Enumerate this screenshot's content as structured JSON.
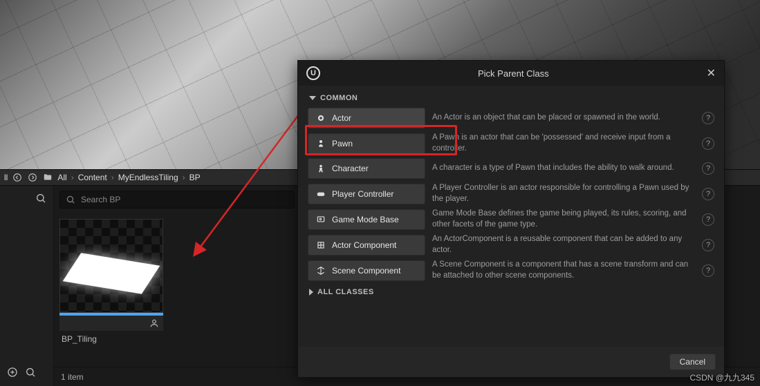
{
  "path": {
    "root": "All",
    "segments": [
      "Content",
      "MyEndlessTiling",
      "BP"
    ]
  },
  "search": {
    "placeholder": "Search BP"
  },
  "asset": {
    "name": "BP_Tiling"
  },
  "status": {
    "count_text": "1 item"
  },
  "dialog": {
    "title": "Pick Parent Class",
    "common_label": "COMMON",
    "all_label": "ALL CLASSES",
    "cancel": "Cancel",
    "items": [
      {
        "label": "Actor",
        "desc": "An Actor is an object that can be placed or spawned in the world.",
        "icon": "actor"
      },
      {
        "label": "Pawn",
        "desc": "A Pawn is an actor that can be 'possessed' and receive input from a controller.",
        "icon": "pawn"
      },
      {
        "label": "Character",
        "desc": "A character is a type of Pawn that includes the ability to walk around.",
        "icon": "character"
      },
      {
        "label": "Player Controller",
        "desc": "A Player Controller is an actor responsible for controlling a Pawn used by the player.",
        "icon": "controller"
      },
      {
        "label": "Game Mode Base",
        "desc": "Game Mode Base defines the game being played, its rules, scoring, and other facets of the game type.",
        "icon": "gamemode"
      },
      {
        "label": "Actor Component",
        "desc": "An ActorComponent is a reusable component that can be added to any actor.",
        "icon": "component"
      },
      {
        "label": "Scene Component",
        "desc": "A Scene Component is a component that has a scene transform and can be attached to other scene components.",
        "icon": "scenecomp"
      }
    ]
  },
  "watermark": "CSDN @九九345"
}
